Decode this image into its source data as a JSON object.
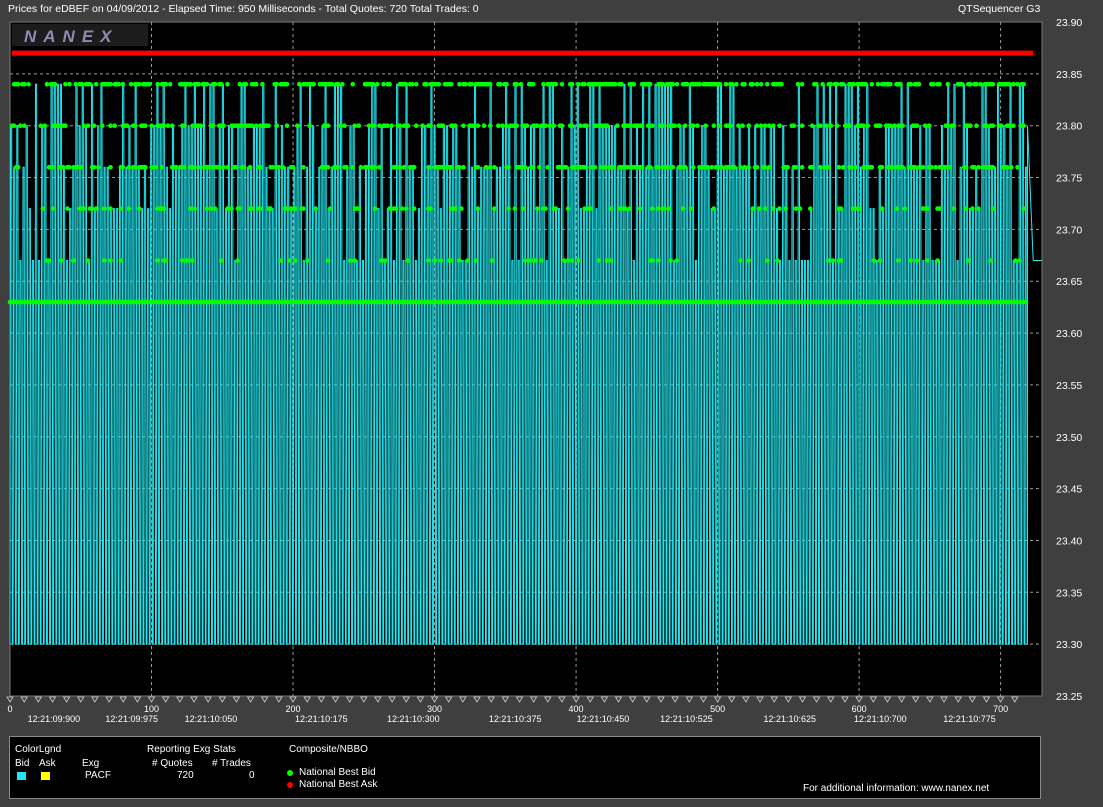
{
  "header": {
    "title": "Prices for  eDBEF  on  04/09/2012  -  Elapsed Time: 950 Milliseconds  -  Total Quotes: 720  Total Trades: 0",
    "app": "QTSequencer G3"
  },
  "logo": {
    "text": "NANEX"
  },
  "colors": {
    "background": "#3f3f3f",
    "plot_bg": "#000000",
    "bid": "#25e6ef",
    "ask": "#ffff00",
    "nbbo_bid": "#00ff00",
    "nbbo_ask": "#ff0000",
    "grid": "#9a9a9a"
  },
  "chart_data": {
    "type": "line",
    "title": "",
    "ylim": [
      23.25,
      23.9
    ],
    "xlim": [
      0,
      725
    ],
    "y_ticks": [
      "23.90",
      "23.85",
      "23.80",
      "23.75",
      "23.70",
      "23.65",
      "23.60",
      "23.55",
      "23.50",
      "23.45",
      "23.40",
      "23.35",
      "23.30",
      "23.25"
    ],
    "x_ticks": [
      0,
      100,
      200,
      300,
      400,
      500,
      600,
      700
    ],
    "time_labels": [
      {
        "label": "12:21:09:900",
        "x": 31
      },
      {
        "label": "12:21:09:975",
        "x": 86
      },
      {
        "label": "12:21:10:050",
        "x": 142
      },
      {
        "label": "12:21:10:175",
        "x": 220
      },
      {
        "label": "12:21:10:300",
        "x": 285
      },
      {
        "label": "12:21:10:375",
        "x": 357
      },
      {
        "label": "12:21:10:450",
        "x": 419
      },
      {
        "label": "12:21:10:525",
        "x": 478
      },
      {
        "label": "12:21:10:625",
        "x": 551
      },
      {
        "label": "12:21:10:700",
        "x": 615
      },
      {
        "label": "12:21:10:775",
        "x": 678
      }
    ],
    "grid": true,
    "series": [
      {
        "name": "National Best Ask",
        "color": "#ff0000",
        "values": [
          23.87
        ]
      },
      {
        "name": "National Best Bid",
        "color": "#00ff00",
        "levels": [
          23.84,
          23.8,
          23.76,
          23.72,
          23.67,
          23.63
        ]
      },
      {
        "name": "Bid",
        "color": "#25e6ef",
        "low": 23.3,
        "high": 23.84
      }
    ]
  },
  "legend": {
    "colorlgnd": "ColorLgnd",
    "bid": "Bid",
    "ask": "Ask",
    "exg_header": "Exg",
    "exg": "PACF",
    "stats_title": "Reporting Exg Stats",
    "quotes_header": "# Quotes",
    "trades_header": "# Trades",
    "quotes": "720",
    "trades": "0",
    "composite_title": "Composite/NBBO",
    "best_bid": "National Best Bid",
    "best_ask": "National Best Ask",
    "info": "For additional information: www.nanex.net"
  }
}
